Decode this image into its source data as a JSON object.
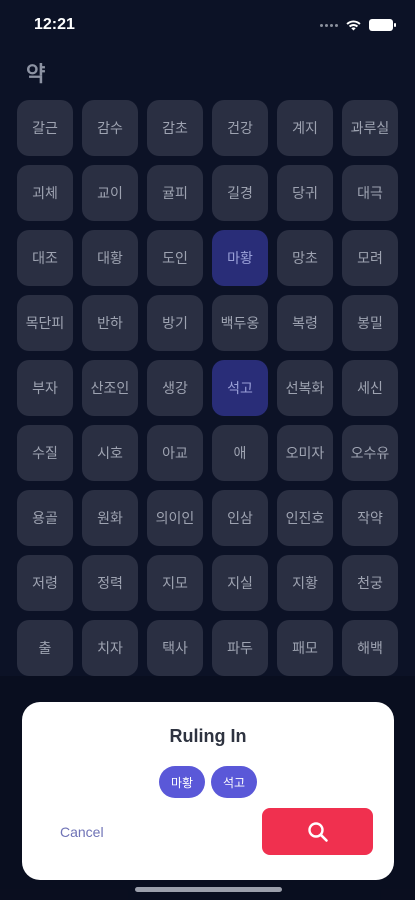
{
  "status_bar": {
    "time": "12:21"
  },
  "section_title": "약",
  "herbs": [
    {
      "label": "갈근",
      "selected": false
    },
    {
      "label": "감수",
      "selected": false
    },
    {
      "label": "감초",
      "selected": false
    },
    {
      "label": "건강",
      "selected": false
    },
    {
      "label": "계지",
      "selected": false
    },
    {
      "label": "과루실",
      "selected": false
    },
    {
      "label": "괴체",
      "selected": false
    },
    {
      "label": "교이",
      "selected": false
    },
    {
      "label": "귤피",
      "selected": false
    },
    {
      "label": "길경",
      "selected": false
    },
    {
      "label": "당귀",
      "selected": false
    },
    {
      "label": "대극",
      "selected": false
    },
    {
      "label": "대조",
      "selected": false
    },
    {
      "label": "대황",
      "selected": false
    },
    {
      "label": "도인",
      "selected": false
    },
    {
      "label": "마황",
      "selected": true
    },
    {
      "label": "망초",
      "selected": false
    },
    {
      "label": "모려",
      "selected": false
    },
    {
      "label": "목단피",
      "selected": false
    },
    {
      "label": "반하",
      "selected": false
    },
    {
      "label": "방기",
      "selected": false
    },
    {
      "label": "백두옹",
      "selected": false
    },
    {
      "label": "복령",
      "selected": false
    },
    {
      "label": "봉밀",
      "selected": false
    },
    {
      "label": "부자",
      "selected": false
    },
    {
      "label": "산조인",
      "selected": false
    },
    {
      "label": "생강",
      "selected": false
    },
    {
      "label": "석고",
      "selected": true
    },
    {
      "label": "선복화",
      "selected": false
    },
    {
      "label": "세신",
      "selected": false
    },
    {
      "label": "수질",
      "selected": false
    },
    {
      "label": "시호",
      "selected": false
    },
    {
      "label": "아교",
      "selected": false
    },
    {
      "label": "애",
      "selected": false
    },
    {
      "label": "오미자",
      "selected": false
    },
    {
      "label": "오수유",
      "selected": false
    },
    {
      "label": "용골",
      "selected": false
    },
    {
      "label": "원화",
      "selected": false
    },
    {
      "label": "의이인",
      "selected": false
    },
    {
      "label": "인삼",
      "selected": false
    },
    {
      "label": "인진호",
      "selected": false
    },
    {
      "label": "작약",
      "selected": false
    },
    {
      "label": "저령",
      "selected": false
    },
    {
      "label": "정력",
      "selected": false
    },
    {
      "label": "지모",
      "selected": false
    },
    {
      "label": "지실",
      "selected": false
    },
    {
      "label": "지황",
      "selected": false
    },
    {
      "label": "천궁",
      "selected": false
    },
    {
      "label": "출",
      "selected": false
    },
    {
      "label": "치자",
      "selected": false
    },
    {
      "label": "택사",
      "selected": false
    },
    {
      "label": "파두",
      "selected": false
    },
    {
      "label": "패모",
      "selected": false
    },
    {
      "label": "해백",
      "selected": false
    }
  ],
  "sheet": {
    "title": "Ruling In",
    "chips": [
      "마황",
      "석고"
    ],
    "cancel_label": "Cancel",
    "search_icon": "search-icon"
  },
  "colors": {
    "background": "#0c1226",
    "tile": "#2a2f42",
    "tile_selected": "#292d78",
    "chip": "#5a58d8",
    "search_button": "#f0304f"
  }
}
